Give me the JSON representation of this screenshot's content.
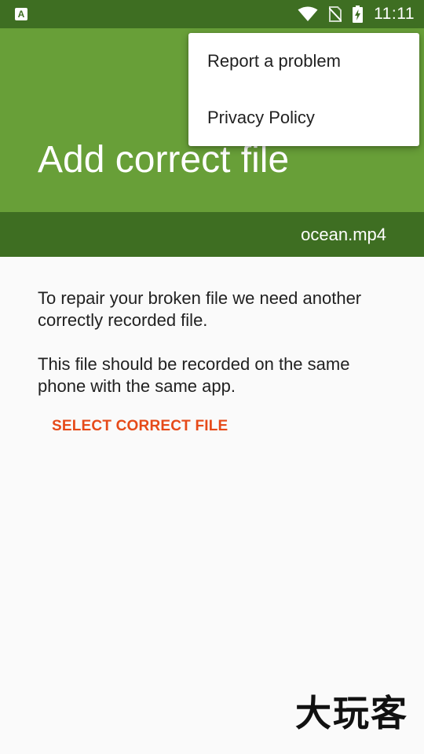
{
  "status_bar": {
    "time": "11:11",
    "app_icon_letter": "A",
    "icons": [
      "app-notification-icon",
      "wifi-icon",
      "no-sim-icon",
      "battery-charging-icon"
    ]
  },
  "app_bar": {
    "title": "Add correct file",
    "background_color": "#689f38"
  },
  "file_bar": {
    "file_name": "ocean.mp4",
    "background_color": "#3e6e22"
  },
  "content": {
    "paragraph_1": "To repair your broken file we need another correctly recorded file.",
    "paragraph_2": "This file should be recorded on the same phone with the same app.",
    "select_button_label": "SELECT CORRECT FILE",
    "accent_color": "#e64a19"
  },
  "overflow_menu": {
    "items": [
      {
        "label": "Report a problem"
      },
      {
        "label": "Privacy Policy"
      }
    ]
  },
  "watermark": {
    "text": "大玩客"
  }
}
